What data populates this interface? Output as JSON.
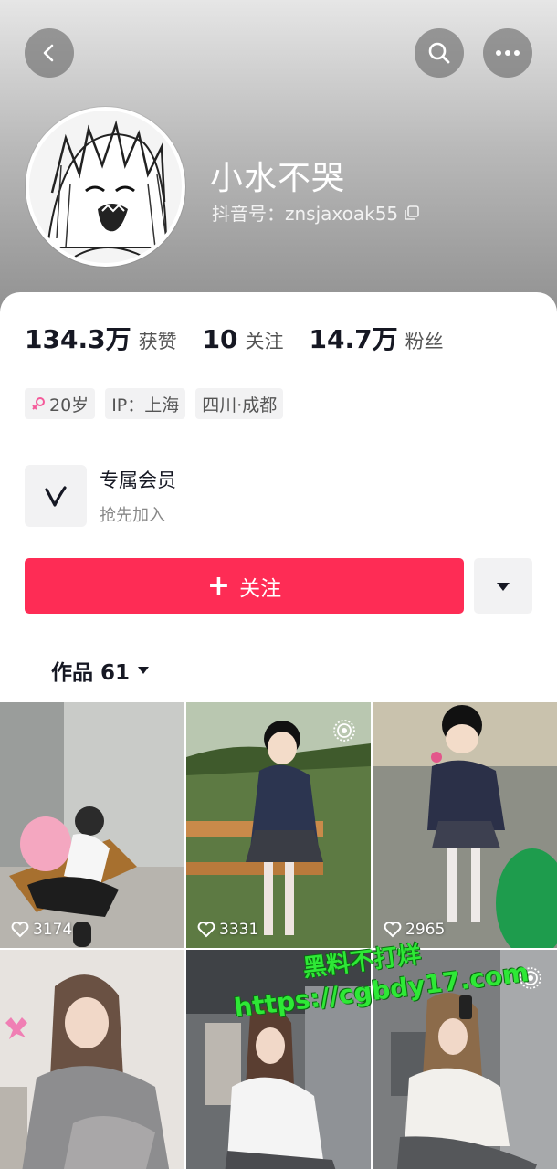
{
  "profile": {
    "nickname": "小水不哭",
    "douyin_id": "抖音号：znsjaxoak55"
  },
  "stats": [
    {
      "value": "134.3万",
      "label": "获赞"
    },
    {
      "value": "10",
      "label": "关注"
    },
    {
      "value": "14.7万",
      "label": "粉丝"
    }
  ],
  "tags": {
    "age": "20岁",
    "ip": "IP：上海",
    "location": "四川·成都"
  },
  "member": {
    "title": "专属会员",
    "subtitle": "抢先加入"
  },
  "follow_button": {
    "label": "关注",
    "plus": "+"
  },
  "works_tab": {
    "label": "作品 61"
  },
  "videos": [
    {
      "likes": "3174"
    },
    {
      "likes": "3331"
    },
    {
      "likes": "2965"
    },
    {
      "likes": ""
    },
    {
      "likes": ""
    },
    {
      "likes": ""
    }
  ],
  "watermark": {
    "line1": "黑料不打烊",
    "line2": "https://cgbdy17.com"
  },
  "colors": {
    "accent": "#fe2c55",
    "watermark": "#2ee836"
  }
}
